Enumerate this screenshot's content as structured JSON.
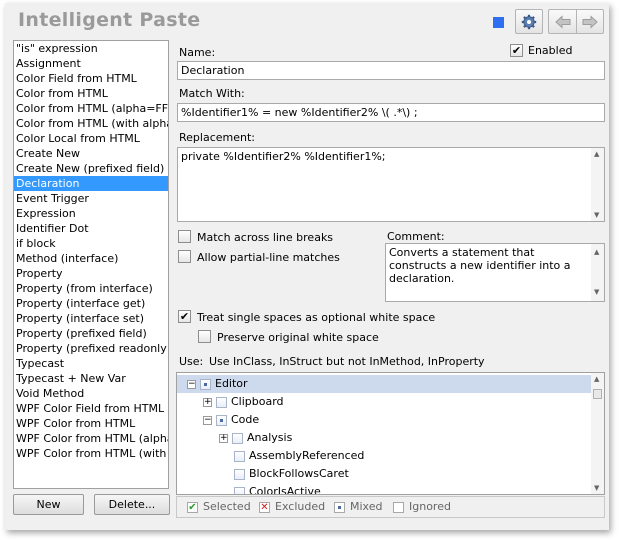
{
  "window": {
    "title": "Intelligent Paste",
    "accent": "#2f6ef0",
    "toolbar": {
      "options_icon": "gear-icon",
      "back_icon": "arrow-left-icon",
      "forward_icon": "arrow-right-icon"
    }
  },
  "list": {
    "items": [
      "\"is\" expression",
      "Assignment",
      "Color Field from HTML",
      "Color from HTML",
      "Color from HTML (alpha=FF)",
      "Color from HTML (with alpha)",
      "Color Local from HTML",
      "Create New",
      "Create New (prefixed field)",
      "Declaration",
      "Event Trigger",
      "Expression",
      "Identifier Dot",
      "if block",
      "Method (interface)",
      "Property",
      "Property (from interface)",
      "Property (interface get)",
      "Property (interface set)",
      "Property (prefixed field)",
      "Property (prefixed readonly field)",
      "Typecast",
      "Typecast + New Var",
      "Void Method",
      "WPF Color Field from HTML",
      "WPF Color from HTML",
      "WPF Color from HTML (alpha=FF)",
      "WPF Color from HTML (with alpha)"
    ],
    "selected": "Declaration",
    "selected_color": "#3399ff"
  },
  "buttons": {
    "new": "New",
    "delete": "Delete..."
  },
  "form": {
    "name_label": "Name:",
    "name_value": "Declaration",
    "enabled_label": "Enabled",
    "enabled_checked": true,
    "match_label": "Match With:",
    "match_value": "%Identifier1% = new %Identifier2% \\( .*\\) ;",
    "replacement_label": "Replacement:",
    "replacement_value": "private %Identifier2% %Identifier1%;",
    "match_across_label": "Match across line breaks",
    "partial_line_label": "Allow partial-line matches",
    "comment_label": "Comment:",
    "comment_value": "Converts a statement that constructs a new identifier into a declaration.",
    "treat_spaces_label": "Treat single spaces as optional white space",
    "treat_spaces_checked": true,
    "preserve_ws_label": "Preserve original white space",
    "use_label": "Use:",
    "use_value": "Use InClass, InStruct but not InMethod, InProperty"
  },
  "tree": {
    "nodes": [
      {
        "label": "Editor",
        "state": "mixed",
        "expander": "−"
      },
      {
        "label": "Clipboard",
        "state": "unchecked",
        "expander": "+"
      },
      {
        "label": "Code",
        "state": "mixed",
        "expander": "−"
      },
      {
        "label": "Analysis",
        "state": "unchecked",
        "expander": "+"
      },
      {
        "label": "AssemblyReferenced",
        "state": "unchecked",
        "expander": ""
      },
      {
        "label": "BlockFollowsCaret",
        "state": "unchecked",
        "expander": ""
      },
      {
        "label": "ColorIsActive",
        "state": "unchecked",
        "expander": ""
      }
    ],
    "highlight_color": "#cdd9ec"
  },
  "legend": {
    "selected": "Selected",
    "excluded": "Excluded",
    "mixed": "Mixed",
    "ignored": "Ignored",
    "selected_color": "#2a9a2a",
    "excluded_color": "#cc2020"
  }
}
